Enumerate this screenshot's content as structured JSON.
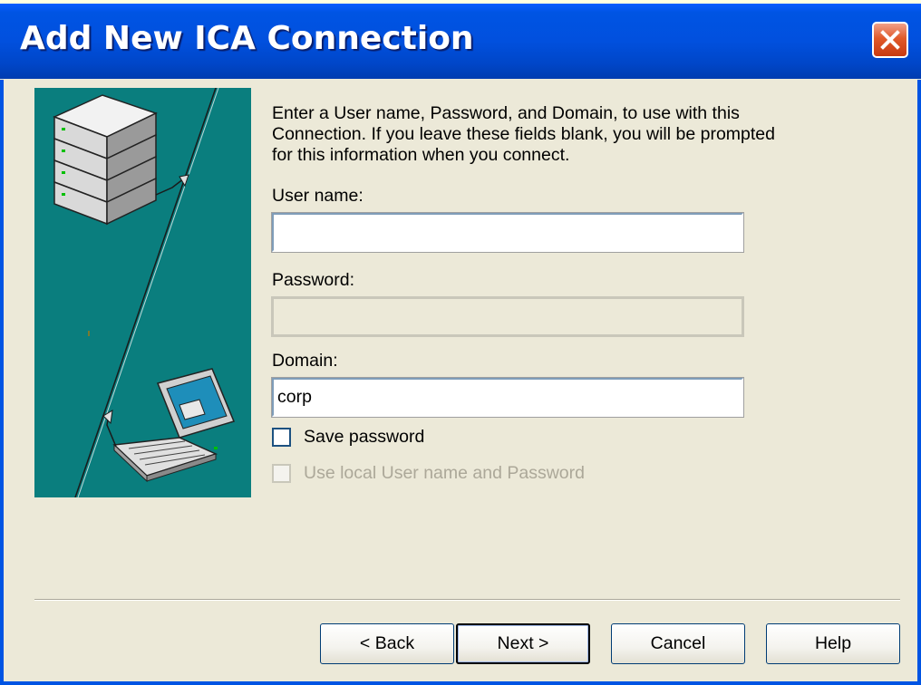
{
  "window": {
    "title": "Add New ICA Connection",
    "close_icon": "close-icon"
  },
  "intro_text": "Enter a User name, Password, and Domain, to use with this Connection.  If you leave these fields blank, you will be prompted for this information when you connect.",
  "form": {
    "username": {
      "label": "User name:",
      "value": ""
    },
    "password": {
      "label": "Password:",
      "value": "",
      "disabled": true
    },
    "domain": {
      "label": "Domain:",
      "value": "corp"
    },
    "save_password": {
      "label": "Save password",
      "checked": false
    },
    "use_local": {
      "label": "Use local User name and Password",
      "checked": false,
      "disabled": true
    }
  },
  "buttons": {
    "back": "< Back",
    "next": "Next >",
    "cancel": "Cancel",
    "help": "Help"
  },
  "colors": {
    "title_bar": "#0054E3",
    "dialog_bg": "#ECE9D8",
    "art_bg": "#0A7E7E",
    "close_button": "#E15A2A"
  }
}
